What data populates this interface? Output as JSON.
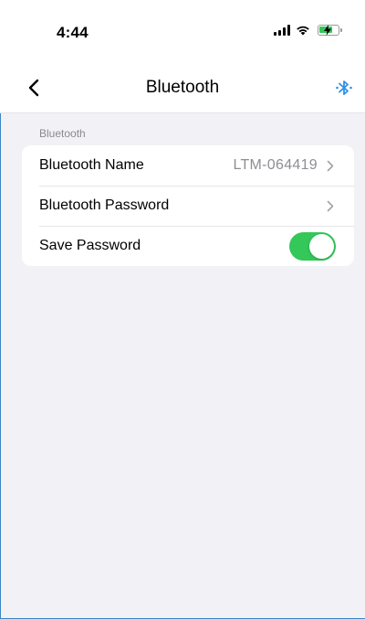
{
  "status_bar": {
    "time": "4:44",
    "icons": [
      "signal-icon",
      "wifi-icon",
      "battery-charging-icon"
    ]
  },
  "nav": {
    "title": "Bluetooth",
    "back_icon": "chevron-left-icon",
    "action_icon": "bluetooth-icon"
  },
  "section": {
    "label": "Bluetooth",
    "rows": [
      {
        "label": "Bluetooth Name",
        "value": "LTM-064419",
        "accessory": "chevron-right-icon"
      },
      {
        "label": "Bluetooth Password",
        "value": "",
        "accessory": "chevron-right-icon"
      },
      {
        "label": "Save Password",
        "toggle_on": true
      }
    ]
  },
  "colors": {
    "accent_blue": "#2f8fe8",
    "toggle_on": "#34c759",
    "background": "#f2f2f6",
    "secondary_text": "#8e8e93"
  }
}
